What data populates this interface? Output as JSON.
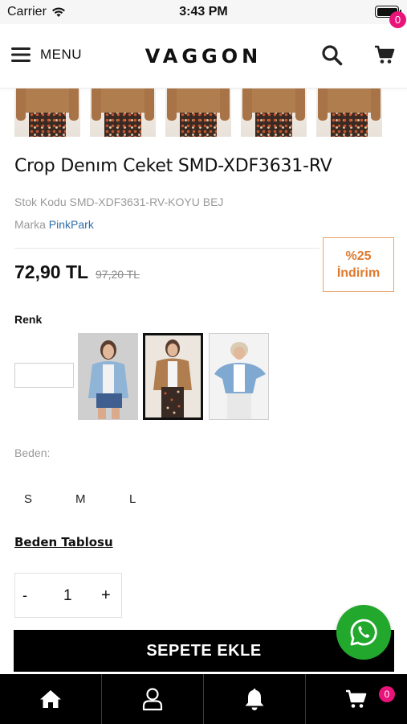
{
  "status_bar": {
    "carrier": "Carrier",
    "time": "3:43 PM"
  },
  "header": {
    "menu_label": "MENU",
    "logo": "VAGGON",
    "cart_count": "0"
  },
  "product": {
    "title": "Crop Denım Ceket SMD-XDF3631-RV",
    "stock_label": "Stok Kodu",
    "stock_code": "SMD-XDF3631-RV-KOYU BEJ",
    "brand_label": "Marka",
    "brand": "PinkPark",
    "price": "72,90 TL",
    "old_price": "97,20 TL",
    "discount_percent": "%25",
    "discount_label": "İndirim"
  },
  "color": {
    "label": "Renk",
    "selected_index": 1
  },
  "size": {
    "label": "Beden:",
    "options": [
      "S",
      "M",
      "L"
    ],
    "size_table": "Beden Tablosu"
  },
  "quantity": {
    "minus": "-",
    "value": "1",
    "plus": "+"
  },
  "add_to_cart": "SEPETE EKLE",
  "bottom_nav": {
    "cart_count": "0"
  },
  "colors": {
    "accent_pink": "#e9147a",
    "discount_orange": "#e07a2e",
    "whatsapp_green": "#23a82e",
    "brand_link": "#2f6fa8"
  }
}
